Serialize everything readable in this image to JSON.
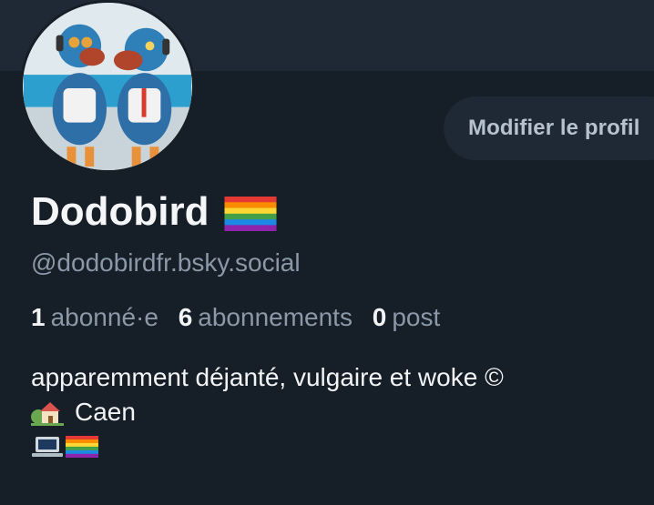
{
  "profile": {
    "display_name": "Dodobird",
    "name_emoji": "rainbow-flag-icon",
    "handle": "@dodobirdfr.bsky.social",
    "edit_button_label": "Modifier le profil"
  },
  "stats": {
    "followers_count": "1",
    "followers_label": "abonné·e",
    "following_count": "6",
    "following_label": "abonnements",
    "posts_count": "0",
    "posts_label": "post"
  },
  "bio": {
    "line1": "apparemment déjanté, vulgaire et woke ©",
    "line2_icon": "house-icon",
    "line2_text": "Caen",
    "line3_icons": [
      "laptop-icon",
      "rainbow-flag-icon"
    ]
  },
  "colors": {
    "background": "#161e27",
    "banner": "#1e2935",
    "primary_text": "#f1f3f5",
    "secondary_text": "#8b98a7",
    "button_bg": "#1e2935",
    "button_text": "#b7c2cf"
  }
}
